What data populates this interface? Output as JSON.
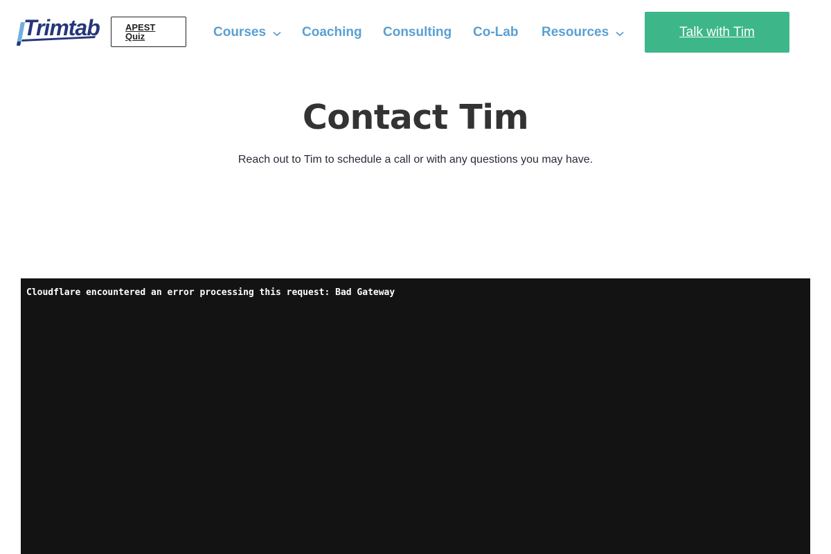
{
  "header": {
    "logo_text": "Trimtab",
    "quiz_button": {
      "line1": "APEST",
      "line2": "Quiz"
    },
    "nav": [
      {
        "label": "Courses",
        "has_dropdown": true,
        "icon": "chevron-down-icon"
      },
      {
        "label": "Coaching",
        "has_dropdown": false
      },
      {
        "label": "Consulting",
        "has_dropdown": false
      },
      {
        "label": "Co-Lab",
        "has_dropdown": false
      },
      {
        "label": "Resources",
        "has_dropdown": true,
        "icon": "chevron-down-icon"
      }
    ],
    "cta_label": "Talk with Tim"
  },
  "main": {
    "title": "Contact Tim",
    "subtitle": "Reach out to Tim to schedule a call or with any questions you may have."
  },
  "embed": {
    "error_message": "Cloudflare encountered an error processing this request: Bad Gateway"
  },
  "colors": {
    "nav_link": "#5aa0d2",
    "cta_background": "#3db78a",
    "logo_navy": "#25367a",
    "logo_light_blue": "#6fb0e0",
    "embed_background": "#131313"
  }
}
